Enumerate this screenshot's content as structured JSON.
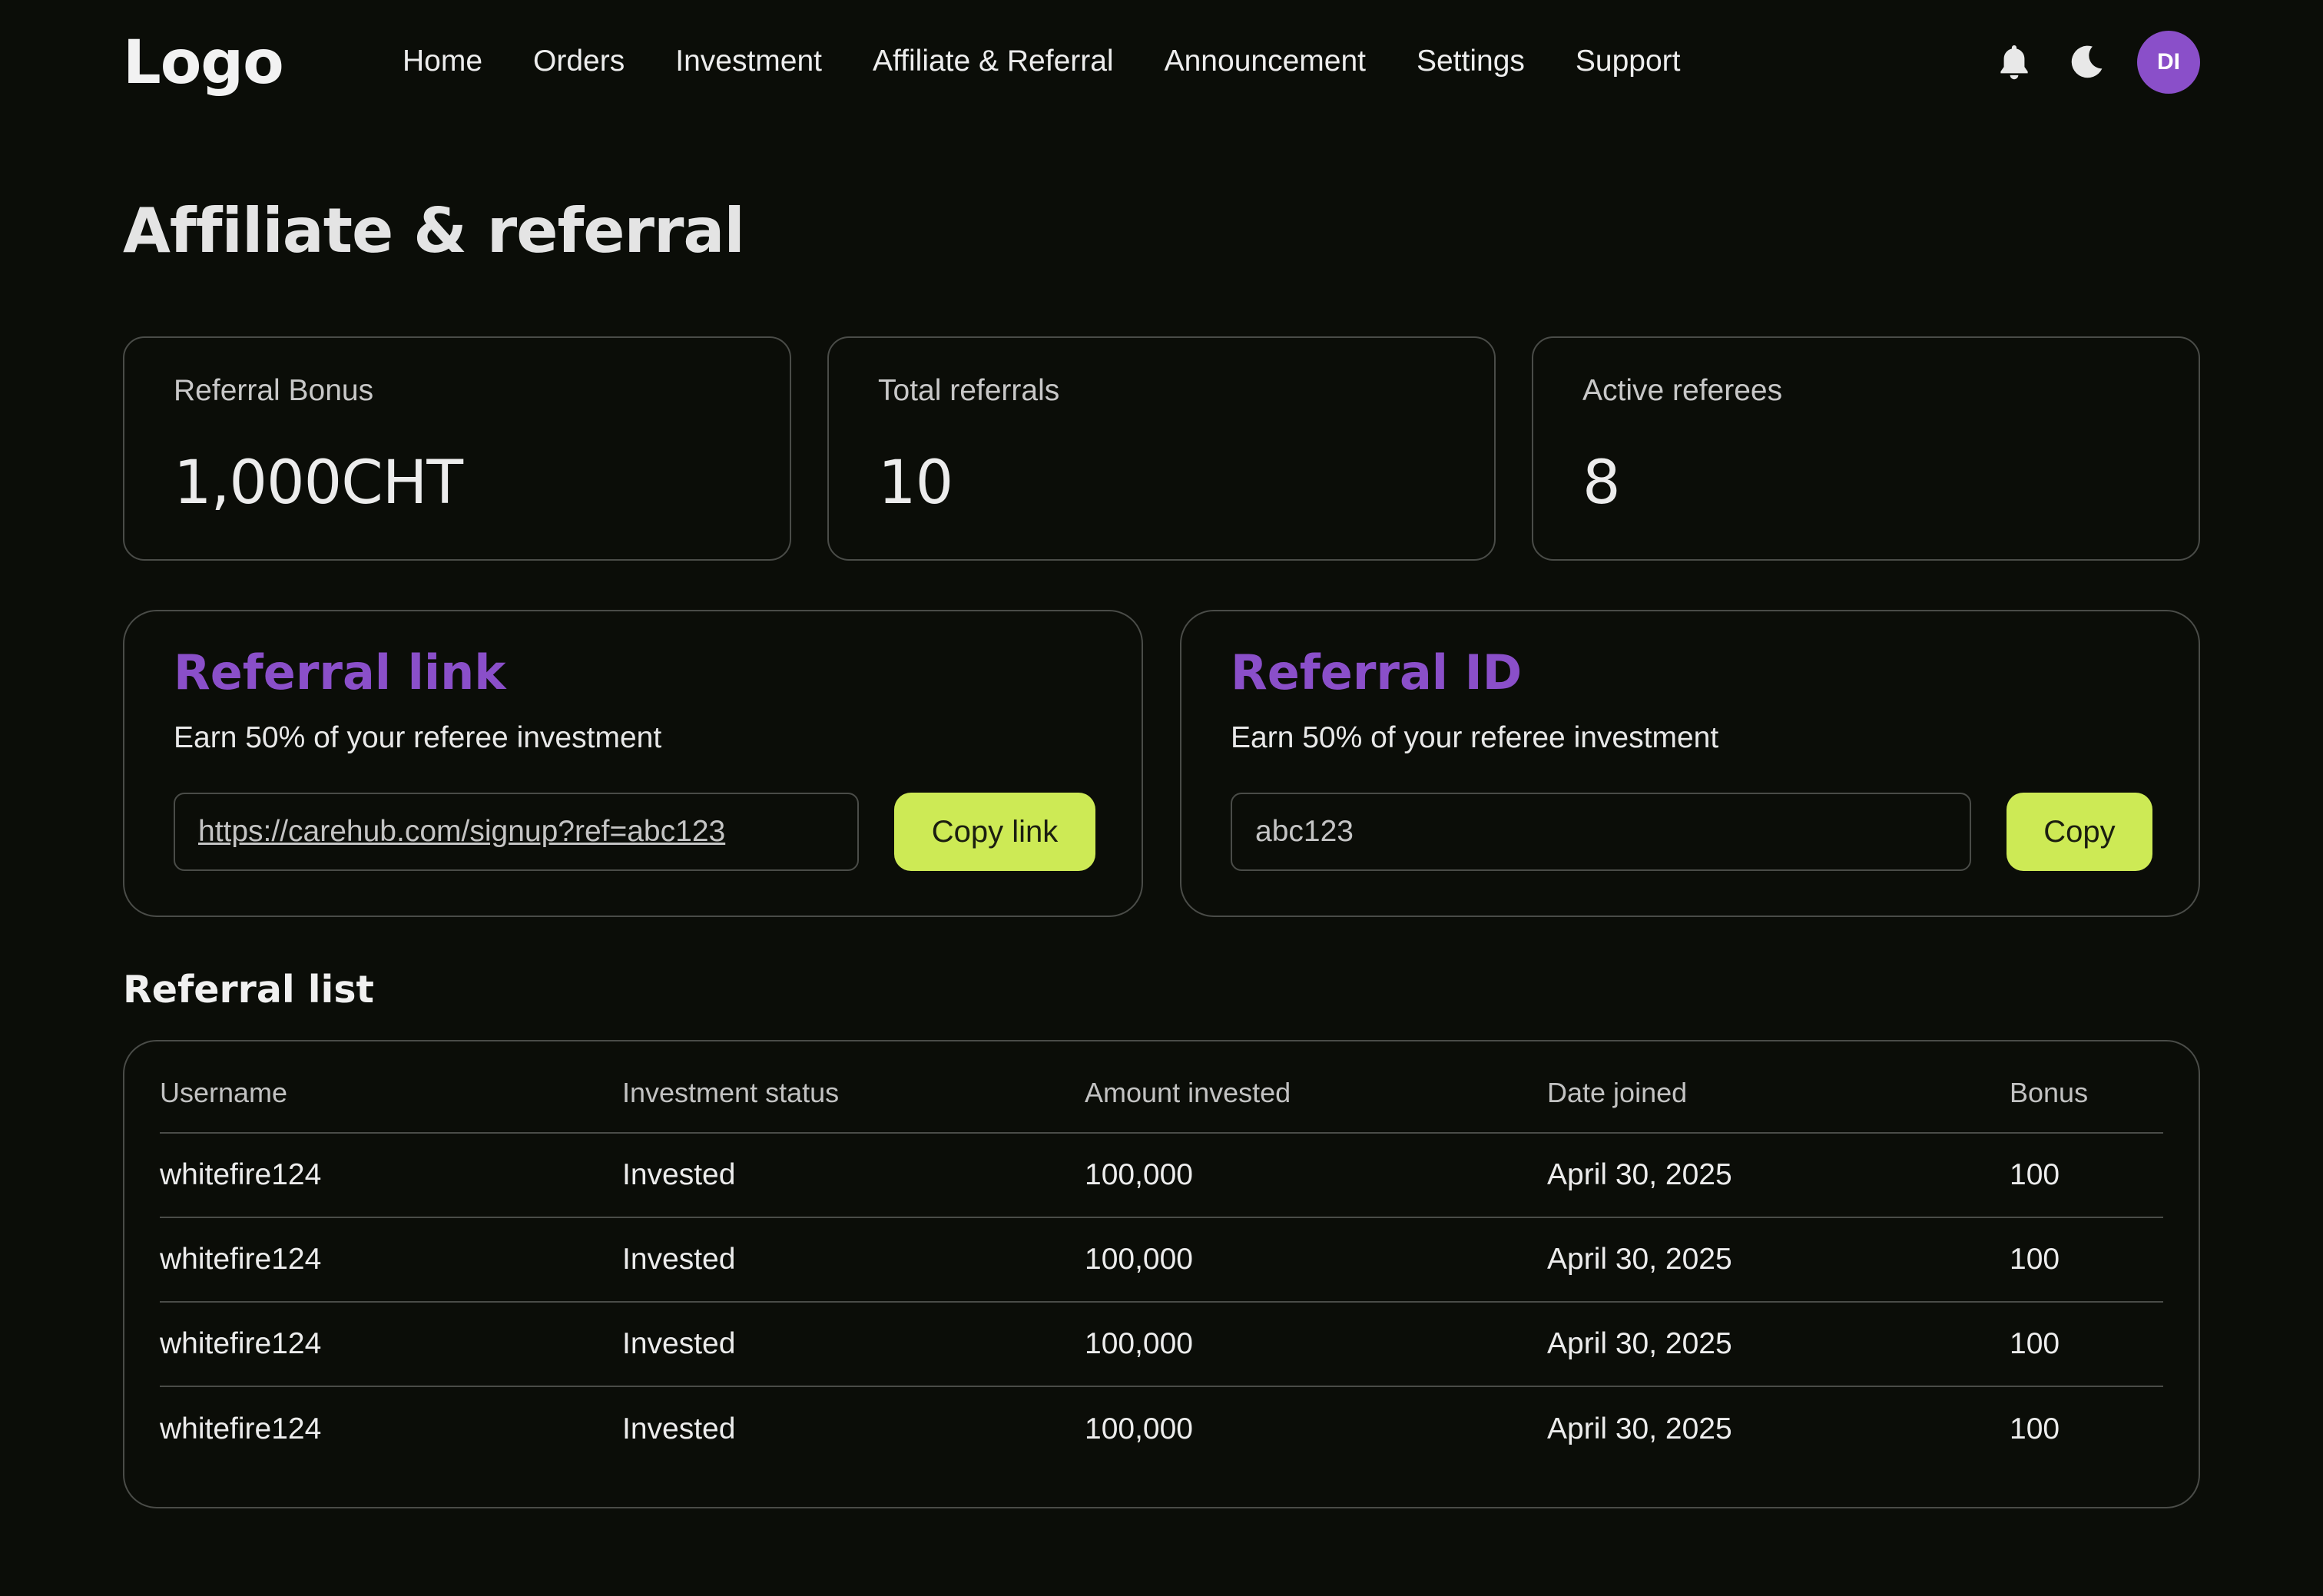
{
  "topbar": {
    "logo": "Logo",
    "nav": [
      "Home",
      "Orders",
      "Investment",
      "Affiliate & Referral",
      "Announcement",
      "Settings",
      "Support"
    ],
    "icons": [
      "bell-icon",
      "moon-icon"
    ],
    "avatar_initials": "DI",
    "avatar_color": "#8a4fc9"
  },
  "page": {
    "title": "Affiliate & referral"
  },
  "stats": [
    {
      "label": "Referral Bonus",
      "value": "1,000CHT"
    },
    {
      "label": "Total referrals",
      "value": "10"
    },
    {
      "label": "Active referees",
      "value": "8"
    }
  ],
  "referral_link": {
    "title": "Referral link",
    "description": "Earn 50% of your referee investment",
    "value": "https://carehub.com/signup?ref=abc123",
    "button": "Copy link"
  },
  "referral_id": {
    "title": "Referral ID",
    "description": "Earn 50% of your referee investment",
    "value": "abc123",
    "button": "Copy"
  },
  "referral_list": {
    "title": "Referral list",
    "columns": [
      "Username",
      "Investment status",
      "Amount invested",
      "Date joined",
      "Bonus"
    ],
    "rows": [
      [
        "whitefire124",
        "Invested",
        "100,000",
        "April 30, 2025",
        "100"
      ],
      [
        "whitefire124",
        "Invested",
        "100,000",
        "April 30, 2025",
        "100"
      ],
      [
        "whitefire124",
        "Invested",
        "100,000",
        "April 30, 2025",
        "100"
      ],
      [
        "whitefire124",
        "Invested",
        "100,000",
        "April 30, 2025",
        "100"
      ]
    ]
  },
  "colors": {
    "background": "#0b0d08",
    "accent_purple": "#8a4fc9",
    "accent_lime": "#cdea55",
    "border": "#4a4c48"
  }
}
